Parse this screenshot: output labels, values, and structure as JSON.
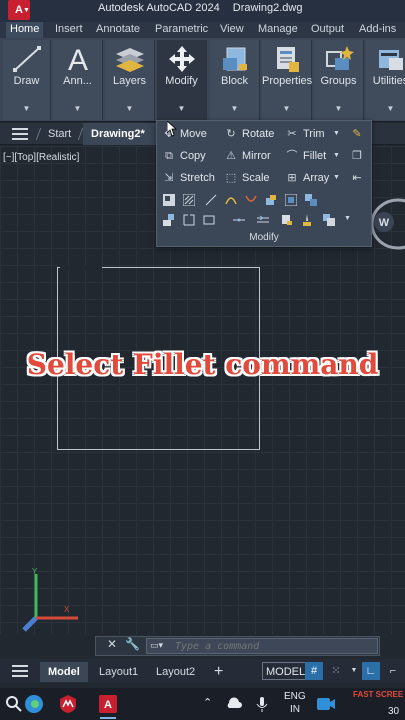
{
  "titlebar": {
    "logo": "A",
    "app_name": "Autodesk AutoCAD 2024",
    "file_name": "Drawing2.dwg"
  },
  "ribbon_tabs": [
    "Home",
    "Insert",
    "Annotate",
    "Parametric",
    "View",
    "Manage",
    "Output",
    "Add-ins"
  ],
  "ribbon_buttons": [
    {
      "label": "Draw",
      "icon": "line-icon"
    },
    {
      "label": "Ann...",
      "icon": "text-a-icon"
    },
    {
      "label": "Layers",
      "icon": "layers-icon"
    },
    {
      "label": "Modify",
      "icon": "move-arrows-icon"
    },
    {
      "label": "Block",
      "icon": "block-icon"
    },
    {
      "label": "Properties",
      "icon": "properties-icon"
    },
    {
      "label": "Groups",
      "icon": "groups-icon"
    },
    {
      "label": "Utilities",
      "icon": "utilities-icon"
    }
  ],
  "file_tabs": {
    "start": "Start",
    "active": "Drawing2*",
    "close": "×"
  },
  "viewport_label": "[−][Top][Realistic]",
  "viewcube_letter": "W",
  "caption": "Select Fillet command",
  "modify_panel": {
    "title": "Modify",
    "row1": [
      "Move",
      "Rotate",
      "Trim"
    ],
    "row2": [
      "Copy",
      "Mirror",
      "Fillet"
    ],
    "row3": [
      "Stretch",
      "Scale",
      "Array"
    ]
  },
  "command_line": {
    "placeholder": "Type a command"
  },
  "layout_tabs": [
    "Model",
    "Layout1",
    "Layout2"
  ],
  "layout_add": "+",
  "status": {
    "model": "MODEL"
  },
  "taskbar": {
    "lang1": "ENG",
    "lang2": "IN",
    "app_hint": "FAST SCREE",
    "time": "30"
  },
  "colors": {
    "accent": "#2b6fa8",
    "caption": "#e24a3b",
    "logo": "#c8202e"
  }
}
